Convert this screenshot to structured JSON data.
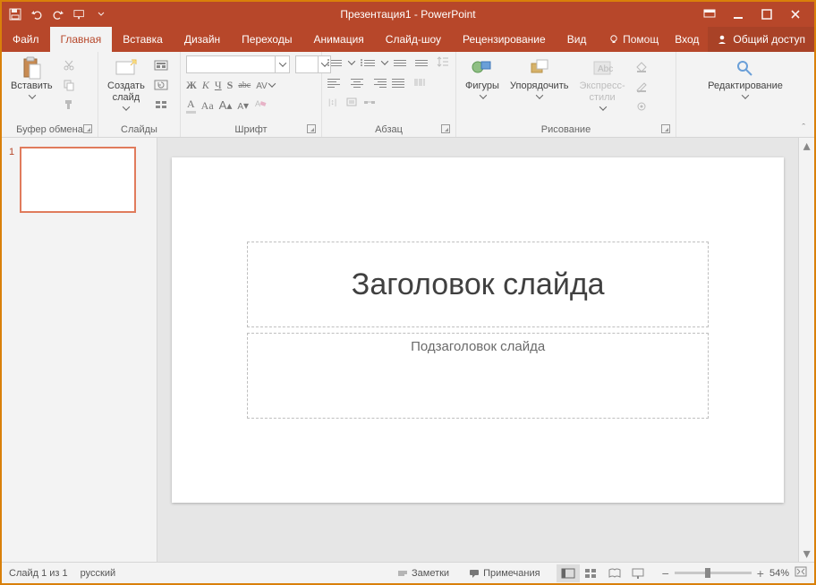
{
  "titlebar": {
    "title": "Презентация1 - PowerPoint"
  },
  "tabs": {
    "file": "Файл",
    "home": "Главная",
    "insert": "Вставка",
    "design": "Дизайн",
    "transitions": "Переходы",
    "animations": "Анимация",
    "slideshow": "Слайд-шоу",
    "review": "Рецензирование",
    "view": "Вид",
    "help_label": "Помощ",
    "signin": "Вход",
    "share": "Общий доступ"
  },
  "ribbon": {
    "clipboard": {
      "paste": "Вставить",
      "label": "Буфер обмена"
    },
    "slides": {
      "new_slide": "Создать\nслайд",
      "label": "Слайды"
    },
    "font": {
      "label": "Шрифт",
      "bold": "Ж",
      "italic": "К",
      "underline": "Ч",
      "strike": "S",
      "shadow": "abc",
      "spacing": "AV",
      "bigA": "A",
      "smallA": "Aa",
      "decA": "A",
      "incA": "A"
    },
    "paragraph": {
      "label": "Абзац"
    },
    "drawing": {
      "shapes": "Фигуры",
      "arrange": "Упорядочить",
      "styles": "Экспресс-\nстили",
      "label": "Рисование"
    },
    "editing": {
      "edit": "Редактирование"
    }
  },
  "slide": {
    "number": "1",
    "title_placeholder": "Заголовок слайда",
    "subtitle_placeholder": "Подзаголовок слайда"
  },
  "statusbar": {
    "slide_of": "Слайд 1 из 1",
    "lang": "русский",
    "notes": "Заметки",
    "comments": "Примечания",
    "zoom": "54%"
  }
}
